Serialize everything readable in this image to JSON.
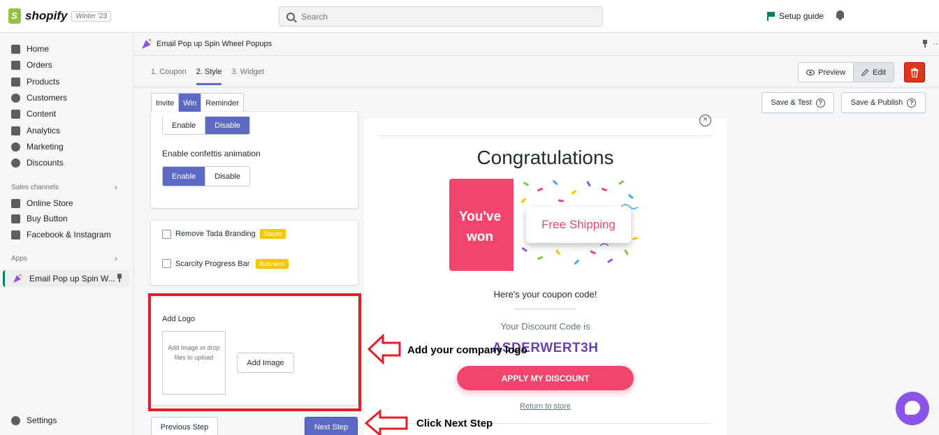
{
  "topbar": {
    "logo_text": "shopify",
    "edition": "Winter '23",
    "search_placeholder": "Search",
    "setup_guide": "Setup guide"
  },
  "sidebar": {
    "items": [
      "Home",
      "Orders",
      "Products",
      "Customers",
      "Content",
      "Analytics",
      "Marketing",
      "Discounts"
    ],
    "sales_channels_label": "Sales channels",
    "channels": [
      "Online Store",
      "Buy Button",
      "Facebook & Instagram"
    ],
    "apps_label": "Apps",
    "active_app": "Email Pop up Spin W...",
    "settings": "Settings"
  },
  "app": {
    "title": "Email Pop up Spin Wheel Popups",
    "steps": [
      "1. Coupon",
      "2. Style",
      "3. Widget"
    ],
    "active_step": 1,
    "preview_label": "Preview",
    "edit_label": "Edit",
    "save_test": "Save & Test",
    "save_publish": "Save & Publish",
    "popup_tabs": [
      "Invite",
      "Win",
      "Reminder"
    ],
    "popup_tab_active": "Win"
  },
  "settings_panel": {
    "enable": "Enable",
    "disable": "Disable",
    "confetti_label": "Enable confettis animation",
    "remove_branding": "Remove Tada Branding",
    "starter_badge": "Starter",
    "scarcity": "Scarcity Progress Bar",
    "business_badge": "Business",
    "add_logo": "Add Logo",
    "dropzone_text": "Add Image or drop files to upload",
    "add_image": "Add Image",
    "prev_step": "Previous Step",
    "next_step": "Next Step"
  },
  "annotations": {
    "logo_note": "Add your company logo",
    "next_note": "Click Next Step"
  },
  "preview_popup": {
    "close_glyph": "×",
    "heading": "Congratulations",
    "ticket_left": "You've won",
    "ticket_prize": "Free Shipping",
    "coupon_intro": "Here's your coupon code!",
    "code_label": "Your Discount Code is",
    "code": "ASDERWERT3H",
    "apply": "APPLY MY DISCOUNT",
    "return": "Return to store"
  },
  "colors": {
    "accent": "#5c6ac4",
    "brand_pink": "#f2456e",
    "code_purple": "#6a3fb2",
    "annotation_red": "#e41e26",
    "shopify_green": "#008060"
  }
}
